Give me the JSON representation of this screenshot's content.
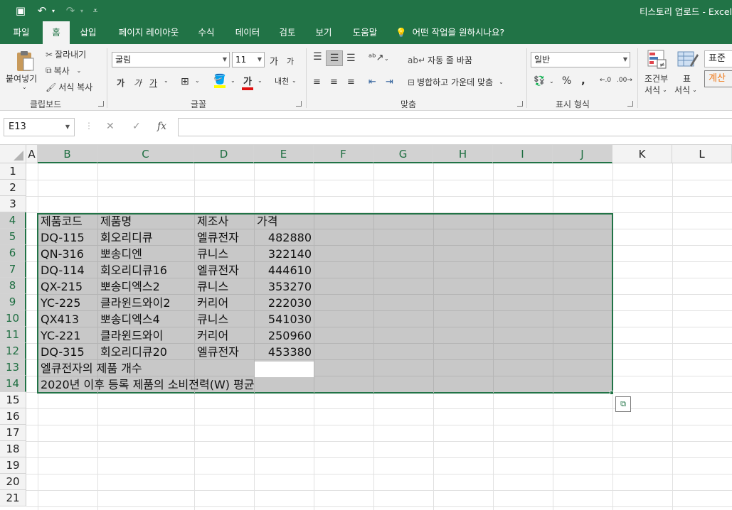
{
  "titlebar": {
    "title": "티스토리 업로드  -  Excel",
    "save_icon": "▣",
    "undo_icon": "↶",
    "redo_icon": "↷",
    "customize_icon": "⩡"
  },
  "tabs": [
    {
      "label": "파일"
    },
    {
      "label": "홈"
    },
    {
      "label": "삽입"
    },
    {
      "label": "페이지 레이아웃"
    },
    {
      "label": "수식"
    },
    {
      "label": "데이터"
    },
    {
      "label": "검토"
    },
    {
      "label": "보기"
    },
    {
      "label": "도움말"
    }
  ],
  "tell_me": "어떤 작업을 원하시나요?",
  "ribbon": {
    "clipboard": {
      "paste": "붙여넣기",
      "cut": "잘라내기",
      "copy": "복사",
      "format_painter": "서식 복사",
      "label": "클립보드"
    },
    "font": {
      "font_name": "굴림",
      "font_size": "11",
      "grow": "가",
      "shrink": "가",
      "bold": "가",
      "italic": "가",
      "underline": "가",
      "phonetic": "내천",
      "label": "글꼴"
    },
    "alignment": {
      "wrap": "자동 줄 바꿈",
      "merge": "병합하고 가운데 맞춤",
      "label": "맞춤"
    },
    "number": {
      "format": "일반",
      "percent": "%",
      "comma": ",",
      "label": "표시 형식"
    },
    "styles": {
      "conditional": "조건부",
      "conditional2": "서식",
      "table": "표",
      "table2": "서식",
      "normal": "표준",
      "calc": "계산"
    }
  },
  "formula_bar": {
    "name_box": "E13",
    "cancel": "✕",
    "enter": "✓",
    "fx": "fx",
    "value": ""
  },
  "columns": [
    "A",
    "B",
    "C",
    "D",
    "E",
    "F",
    "G",
    "H",
    "I",
    "J",
    "K",
    "L"
  ],
  "rows": [
    "1",
    "2",
    "3",
    "4",
    "5",
    "6",
    "7",
    "8",
    "9",
    "10",
    "11",
    "12",
    "13",
    "14",
    "15",
    "16",
    "17",
    "18",
    "19",
    "20",
    "21"
  ],
  "sheet": {
    "header": {
      "code": "제품코드",
      "name": "제품명",
      "maker": "제조사",
      "price": "가격"
    },
    "records": [
      {
        "code": "DQ-115",
        "name": "회오리디큐",
        "maker": "엘큐전자",
        "price": "482880"
      },
      {
        "code": "QN-316",
        "name": "뽀송디엔",
        "maker": "큐니스",
        "price": "322140"
      },
      {
        "code": "DQ-114",
        "name": "회오리디큐16",
        "maker": "엘큐전자",
        "price": "444610"
      },
      {
        "code": "QX-215",
        "name": "뽀송디엑스2",
        "maker": "큐니스",
        "price": "353270"
      },
      {
        "code": "YC-225",
        "name": "클라윈드와이2",
        "maker": "커리어",
        "price": "222030"
      },
      {
        "code": "QX413",
        "name": "뽀송디엑스4",
        "maker": "큐니스",
        "price": "541030"
      },
      {
        "code": "YC-221",
        "name": "클라윈드와이",
        "maker": "커리어",
        "price": "250960"
      },
      {
        "code": "DQ-315",
        "name": "회오리디큐20",
        "maker": "엘큐전자",
        "price": "453380"
      }
    ],
    "row13_label": "엘큐전자의 제품 개수",
    "row14_label": "2020년 이후 등록 제품의 소비전력(W) 평균"
  }
}
